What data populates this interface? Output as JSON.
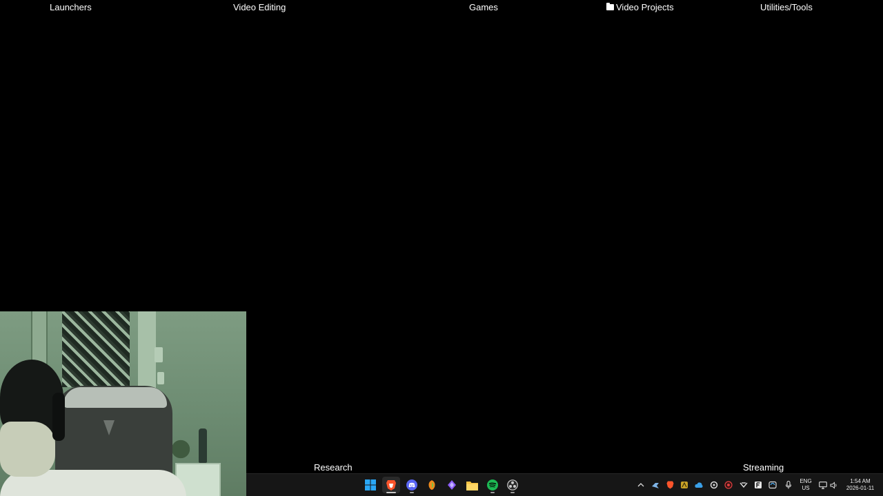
{
  "desktop": {
    "groups": {
      "launchers": "Launchers",
      "video_editing": "Video Editing",
      "games": "Games",
      "video_projects": "Video Projects",
      "utilities_tools": "Utilities/Tools",
      "research": "Research",
      "streaming": "Streaming"
    }
  },
  "taskbar": {
    "apps": [
      {
        "name": "start",
        "icon": "windows-icon"
      },
      {
        "name": "brave",
        "icon": "brave-icon",
        "active": true
      },
      {
        "name": "discord",
        "icon": "discord-icon"
      },
      {
        "name": "fl-studio",
        "icon": "fl-studio-icon"
      },
      {
        "name": "app-purple",
        "icon": "purple-app-icon"
      },
      {
        "name": "file-explorer",
        "icon": "folder-icon"
      },
      {
        "name": "spotify",
        "icon": "spotify-icon"
      },
      {
        "name": "obs",
        "icon": "obs-icon"
      }
    ],
    "tray": {
      "language_line1": "ENG",
      "language_line2": "US",
      "time": "1:54 AM",
      "date": "2026-01-11"
    }
  },
  "colors": {
    "desktop_bg": "#000000",
    "taskbar_bg": "#161616",
    "windows_blue": "#2aa7f5",
    "brave_orange": "#fb542b",
    "discord_blurple": "#5865f2",
    "spotify_green": "#1db954",
    "folder_yellow": "#f5c242"
  }
}
